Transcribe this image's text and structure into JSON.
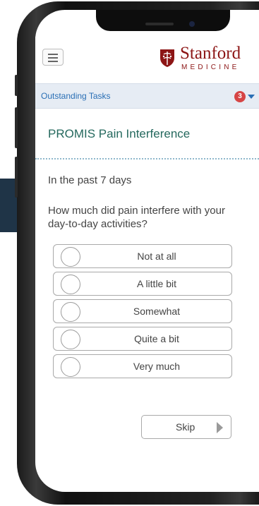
{
  "brand": {
    "name": "Stanford",
    "subtitle": "MEDICINE",
    "color": "#8c1515"
  },
  "header": {
    "menu_icon": "hamburger-menu-icon",
    "logo_icon": "stanford-shield-icon"
  },
  "tasks": {
    "label": "Outstanding Tasks",
    "count": "3",
    "badge_color": "#d64545",
    "dropdown_icon": "caret-down-icon"
  },
  "survey": {
    "title": "PROMIS Pain Interference",
    "period": "In the past 7 days",
    "question": "How much did pain interfere with your day-to-day activities?",
    "options": [
      "Not at all",
      "A little bit",
      "Somewhat",
      "Quite a bit",
      "Very much"
    ],
    "skip_label": "Skip",
    "skip_icon": "play-arrow-icon"
  }
}
